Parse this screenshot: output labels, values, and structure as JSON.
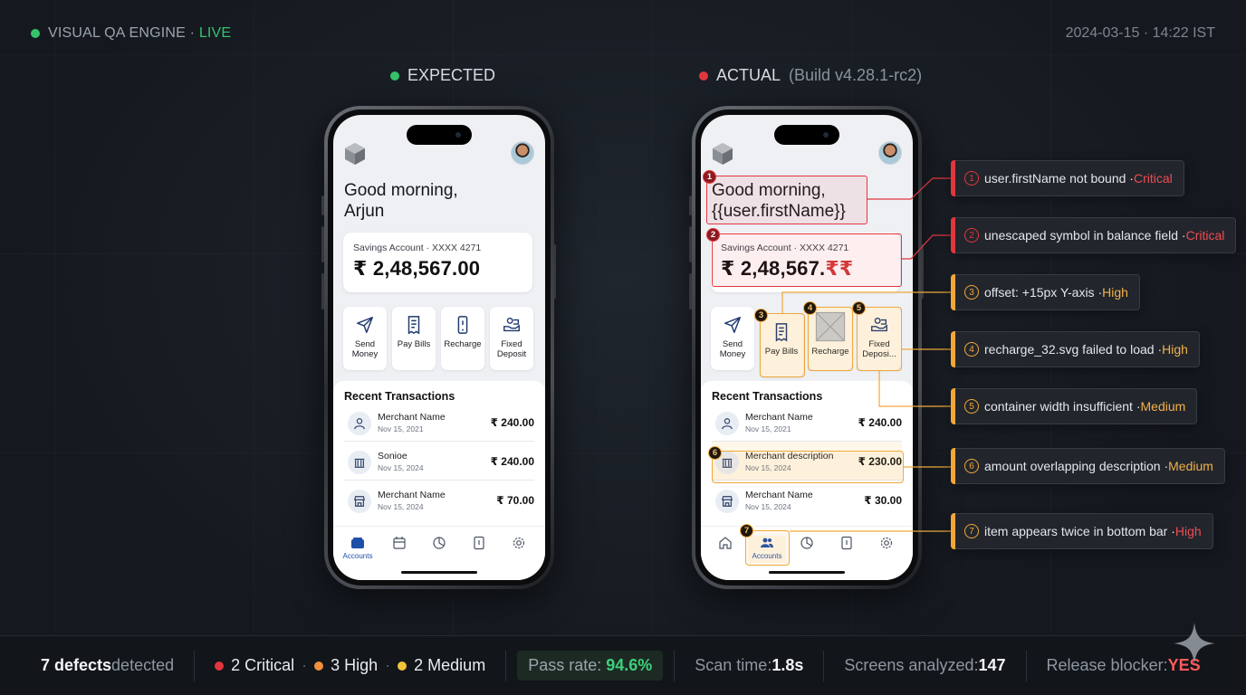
{
  "header": {
    "engine_label": "VISUAL QA ENGINE · ",
    "live_label": "LIVE",
    "timestamp": "2024-03-15 · 14:22 IST",
    "live_color": "#36c26c"
  },
  "expected": {
    "title": "EXPECTED",
    "status_color": "#36c26c"
  },
  "actual": {
    "title": "ACTUAL",
    "build": "(Build v4.28.1-rc2)",
    "status_color": "#e2363d"
  },
  "expected_screen": {
    "greeting_line1": "Good morning,",
    "greeting_line2": "Arjun",
    "account_label": "Savings Account · XXXX 4271",
    "balance": "₹ 2,48,567.00",
    "actions": [
      {
        "label": "Send Money",
        "icon": "send-icon"
      },
      {
        "label": "Pay Bills",
        "icon": "bill-icon"
      },
      {
        "label": "Recharge",
        "icon": "phone-icon"
      },
      {
        "label": "Fixed Deposit",
        "icon": "deposit-icon"
      }
    ],
    "transactions_title": "Recent Transactions",
    "transactions": [
      {
        "name": "Merchant Name",
        "date": "Nov 15, 2021",
        "amount": "₹ 240.00",
        "icon": "person-icon"
      },
      {
        "name": "Sonioe",
        "date": "Nov 15, 2024",
        "amount": "₹ 240.00",
        "icon": "bank-icon"
      },
      {
        "name": "Merchant Name",
        "date": "Nov 15, 2024",
        "amount": "₹ 70.00",
        "icon": "store-icon"
      }
    ],
    "nav_active_label": "Accounts"
  },
  "actual_screen": {
    "greeting_line1": "Good morning,",
    "greeting_line2": "{{user.firstName}}",
    "account_label": "Savings Account · XXXX 4271",
    "balance_main": "₹ 2,48,567.",
    "balance_bad": "₹₹",
    "actions": [
      {
        "label": "Send Money",
        "icon": "send-icon"
      },
      {
        "label": "Pay Bills",
        "icon": "bill-icon"
      },
      {
        "label": "Recharge",
        "icon": "broken-image-icon"
      },
      {
        "label": "Fixed Deposi...",
        "icon": "deposit-icon"
      }
    ],
    "transactions_title": "Recent Transactions",
    "transactions": [
      {
        "name": "Merchant Name",
        "date": "Nov 15, 2021",
        "amount": "₹ 240.00",
        "icon": "person-icon"
      },
      {
        "name": "Merchant description",
        "date": "Nov 15, 2024",
        "amount": "₹ 230.00",
        "icon": "bank-icon"
      },
      {
        "name": "Merchant Name",
        "date": "Nov 15, 2024",
        "amount": "₹ 30.00",
        "icon": "store-icon"
      }
    ],
    "nav_active_label": "Accounts"
  },
  "defects": [
    {
      "num": "1",
      "text": "user.firstName not bound · ",
      "severity": "Critical"
    },
    {
      "num": "2",
      "text": "unescaped symbol in balance field · ",
      "severity": "Critical"
    },
    {
      "num": "3",
      "text": "offset: +15px Y-axis · ",
      "severity": "High"
    },
    {
      "num": "4",
      "text": "recharge_32.svg failed to load · ",
      "severity": "High"
    },
    {
      "num": "5",
      "text": "container width insufficient · ",
      "severity": "Medium"
    },
    {
      "num": "6",
      "text": "amount overlapping description · ",
      "severity": "Medium"
    },
    {
      "num": "7",
      "text": "item appears twice in bottom bar · ",
      "severity": "High"
    }
  ],
  "defect_badges": {
    "b1": "1",
    "b2": "2",
    "b3": "3",
    "b4": "4",
    "b5": "5",
    "b6": "6",
    "b7": "7"
  },
  "footer": {
    "defects_count": "7 defects",
    "defects_suffix": " detected",
    "critical": "2 Critical",
    "high": "3 High",
    "medium": "2 Medium",
    "pass_label": "Pass rate: ",
    "pass_value": "94.6%",
    "scan_label": "Scan time: ",
    "scan_value": "1.8s",
    "screens_label": "Screens analyzed: ",
    "screens_value": "147",
    "blocker_label": "Release blocker: ",
    "blocker_value": "YES",
    "critical_color": "#e2363d",
    "high_color": "#f0903a",
    "medium_color": "#f2c23a"
  },
  "colors": {
    "critical": "#e2363d",
    "high": "#f0a73a",
    "pass": "#3ed07a"
  }
}
